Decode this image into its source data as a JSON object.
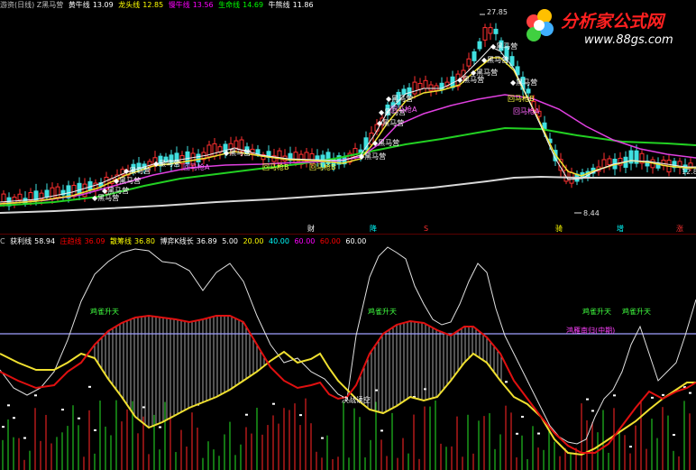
{
  "main_legend": {
    "title": "游资(日线) Z黑马营",
    "items": [
      {
        "label": "黄牛线",
        "value": "13.09",
        "color": "#ffffff"
      },
      {
        "label": "龙头线",
        "value": "12.85",
        "color": "#ffff00"
      },
      {
        "label": "慢牛线",
        "value": "13.56",
        "color": "#ff00ff"
      },
      {
        "label": "生命线",
        "value": "14.69",
        "color": "#00ff00"
      },
      {
        "label": "牛熊线",
        "value": "11.86",
        "color": "#ffffff"
      }
    ]
  },
  "main_annotations": {
    "high_price": "27.85",
    "low_price": "8.44",
    "last_price": "12.8",
    "black_horse": "黑马营",
    "pullback_a": "回马枪A",
    "pullback_b": "回马枪B",
    "wealth_mark": "财",
    "peak_mark_1": "降",
    "peak_mark_2": "S",
    "right_mark_1": "骑",
    "right_mark_2": "增",
    "right_mark_3": "涨"
  },
  "sub_legend": {
    "prefix": "C",
    "items": [
      {
        "label": "获利线",
        "value": "58.94",
        "color": "#ffffff"
      },
      {
        "label": "庄趋线",
        "value": "36.09",
        "color": "#ff0000"
      },
      {
        "label": "散筹线",
        "value": "36.80",
        "color": "#ffff00"
      },
      {
        "label": "博弈K线长",
        "value": "36.89",
        "color": "#ffffff"
      }
    ],
    "levels": [
      {
        "value": "5.00",
        "color": "#ffffff"
      },
      {
        "value": "20.00",
        "color": "#ffff00"
      },
      {
        "value": "40.00",
        "color": "#00ffff"
      },
      {
        "value": "60.00",
        "color": "#ff00ff"
      },
      {
        "value": "60.00",
        "color": "#ff0000"
      },
      {
        "value": "60.00",
        "color": "#ffffff"
      }
    ]
  },
  "sub_annotations": {
    "phoenix_1": "鸡雀升天",
    "phoenix_2": "鸡雀升天",
    "phoenix_3": "鸡雀升天",
    "phoenix_4": "鸡雀升天",
    "pink_note": "鸿雁南归(中期)",
    "dump_note": "决战诱空"
  },
  "logo": {
    "brand": "分析家公式网",
    "url": "www.88gs.com"
  }
}
